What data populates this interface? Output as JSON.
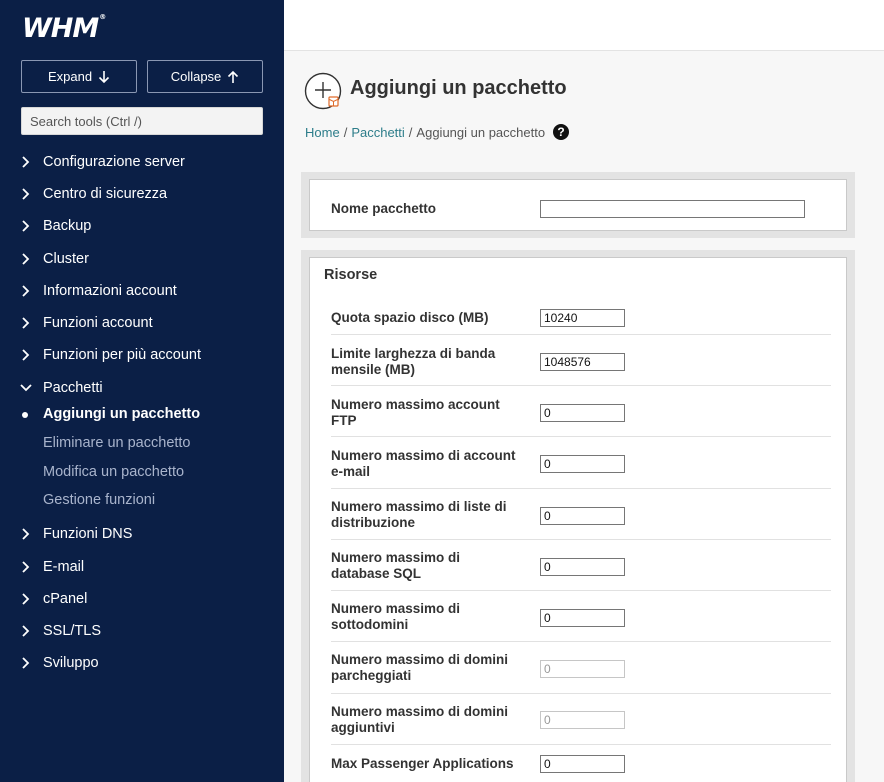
{
  "brand": {
    "logo": "WHM"
  },
  "sidebar": {
    "expand_label": "Expand",
    "collapse_label": "Collapse",
    "search_placeholder": "Search tools (Ctrl /)",
    "items": [
      {
        "label": "Configurazione server"
      },
      {
        "label": "Centro di sicurezza"
      },
      {
        "label": "Backup"
      },
      {
        "label": "Cluster"
      },
      {
        "label": "Informazioni account"
      },
      {
        "label": "Funzioni account"
      },
      {
        "label": "Funzioni per più account"
      },
      {
        "label": "Pacchetti"
      },
      {
        "label": "Funzioni DNS"
      },
      {
        "label": "E-mail"
      },
      {
        "label": "cPanel"
      },
      {
        "label": "SSL/TLS"
      },
      {
        "label": "Sviluppo"
      }
    ],
    "subitems": [
      {
        "label": "Aggiungi un pacchetto"
      },
      {
        "label": "Eliminare un pacchetto"
      },
      {
        "label": "Modifica un pacchetto"
      },
      {
        "label": "Gestione funzioni"
      }
    ]
  },
  "page": {
    "title": "Aggiungi un pacchetto",
    "breadcrumb": {
      "home": "Home",
      "packages": "Pacchetti",
      "current": "Aggiungi un pacchetto",
      "sep": "/"
    }
  },
  "form": {
    "package_name_label": "Nome pacchetto",
    "package_name_value": "",
    "resources_title": "Risorse",
    "fields": [
      {
        "label": "Quota spazio disco (MB)",
        "value": "10240"
      },
      {
        "label": "Limite larghezza di banda mensile (MB)",
        "value": "1048576"
      },
      {
        "label": "Numero massimo account FTP",
        "value": "0"
      },
      {
        "label": "Numero massimo di account e-mail",
        "value": "0"
      },
      {
        "label": "Numero massimo di liste di distribuzione",
        "value": "0"
      },
      {
        "label": "Numero massimo di database SQL",
        "value": "0"
      },
      {
        "label": "Numero massimo di sottodomini",
        "value": "0"
      },
      {
        "label": "Numero massimo di domini parcheggiati",
        "value": "0"
      },
      {
        "label": "Numero massimo di domini aggiuntivi",
        "value": "0"
      },
      {
        "label": "Max Passenger Applications",
        "value": "0"
      }
    ]
  }
}
